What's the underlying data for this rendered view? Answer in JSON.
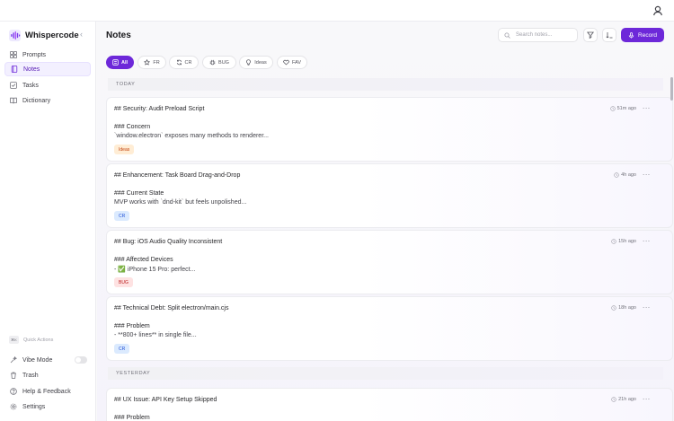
{
  "app": {
    "name": "Whispercode",
    "logo_color": "#7c3aed"
  },
  "sidebar": {
    "items": [
      {
        "label": "Prompts",
        "icon": "grid-icon"
      },
      {
        "label": "Notes",
        "icon": "notebook-icon",
        "active": true
      },
      {
        "label": "Tasks",
        "icon": "checkbox-icon"
      },
      {
        "label": "Dictionary",
        "icon": "book-icon"
      }
    ],
    "quick_actions": {
      "kbd": "⌘K",
      "label": "Quick Actions"
    },
    "bottom": [
      {
        "label": "Vibe Mode",
        "icon": "sparkle-icon",
        "toggle": false
      },
      {
        "label": "Trash",
        "icon": "trash-icon"
      },
      {
        "label": "Help & Feedback",
        "icon": "help-icon"
      },
      {
        "label": "Settings",
        "icon": "gear-icon"
      }
    ]
  },
  "header": {
    "title": "Notes",
    "search_placeholder": "Search notes...",
    "record_label": "Record",
    "accent": "#6d28d9"
  },
  "filters": [
    {
      "label": "All",
      "icon": "list-icon",
      "active": true
    },
    {
      "label": "FR",
      "icon": "star-icon"
    },
    {
      "label": "CR",
      "icon": "refresh-icon"
    },
    {
      "label": "BUG",
      "icon": "bug-icon"
    },
    {
      "label": "Ideas",
      "icon": "bulb-icon"
    },
    {
      "label": "FAV",
      "icon": "heart-icon"
    }
  ],
  "groups": {
    "today": "TODAY",
    "yesterday": "YESTERDAY"
  },
  "notes": [
    {
      "title": "## Security: Audit Preload Script",
      "time": "51m ago",
      "heading": "### Concern",
      "body": "`window.electron` exposes many methods to renderer...",
      "tag": "Ideas",
      "tag_bg": "#ffedd5",
      "tag_fg": "#c2410c"
    },
    {
      "title": "## Enhancement: Task Board Drag-and-Drop",
      "time": "4h ago",
      "heading": "### Current State",
      "body": "MVP works with `dnd-kit` but feels unpolished...",
      "tag": "CR",
      "tag_bg": "#dbeafe",
      "tag_fg": "#1d4ed8"
    },
    {
      "title": "## Bug: iOS Audio Quality Inconsistent",
      "time": "15h ago",
      "heading": "### Affected Devices",
      "body": "- ✅ iPhone 15 Pro: perfect...",
      "tag": "BUG",
      "tag_bg": "#fee2e2",
      "tag_fg": "#b91c1c"
    },
    {
      "title": "## Technical Debt: Split electron/main.cjs",
      "time": "18h ago",
      "heading": "### Problem",
      "body": "- **800+ lines** in single file...",
      "tag": "CR",
      "tag_bg": "#dbeafe",
      "tag_fg": "#1d4ed8"
    },
    {
      "title": "## UX Issue: API Key Setup Skipped",
      "time": "21h ago",
      "heading": "### Problem",
      "body": "",
      "tag": "",
      "tag_bg": "",
      "tag_fg": ""
    }
  ]
}
